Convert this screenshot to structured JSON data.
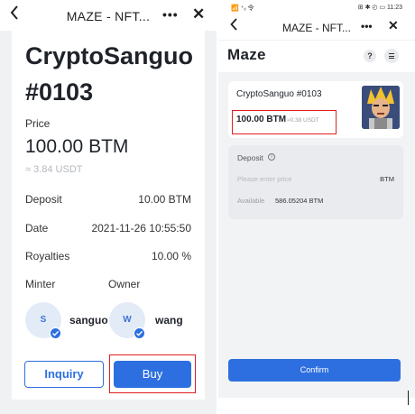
{
  "left_screen": {
    "nav": {
      "back_icon": "chevron-left-icon",
      "title": "MAZE - NFT...",
      "more": "•••",
      "close": "✕"
    },
    "nft_title": "CryptoSanguo #0103",
    "price_label": "Price",
    "price_value": "100.00 BTM",
    "price_usd": "≈ 3.84 USDT",
    "rows": [
      {
        "label": "Deposit",
        "value": "10.00 BTM"
      },
      {
        "label": "Date",
        "value": "2021-11-26 10:55:50"
      },
      {
        "label": "Royalties",
        "value": "10.00 %"
      }
    ],
    "minter": {
      "label": "Minter",
      "initial": "S",
      "name": "sanguo"
    },
    "owner": {
      "label": "Owner",
      "initial": "W",
      "name": "wang"
    },
    "inquiry_button": "Inquiry",
    "buy_button": "Buy"
  },
  "right_screen": {
    "status": {
      "left": "📶 ⁺ᵢᵢ 令",
      "right": "⊞ ✱ ◴ ▭ 11:23"
    },
    "nav": {
      "back_icon": "chevron-left-icon",
      "title": "MAZE - NFT...",
      "more": "•••",
      "close": "✕"
    },
    "logo": "Maze",
    "help_icon": "?",
    "card": {
      "name": "CryptoSanguo #0103",
      "price": "100.00 BTM",
      "price_usd": "≈0.38 USDT"
    },
    "deposit": {
      "label": "Deposit",
      "placeholder": "Please enter price",
      "unit": "BTM",
      "available_label": "Available",
      "available_value": "586.05204 BTM"
    },
    "confirm_button": "Confirm"
  },
  "colors": {
    "primary": "#2d6fe0",
    "highlight": "#e02020"
  }
}
